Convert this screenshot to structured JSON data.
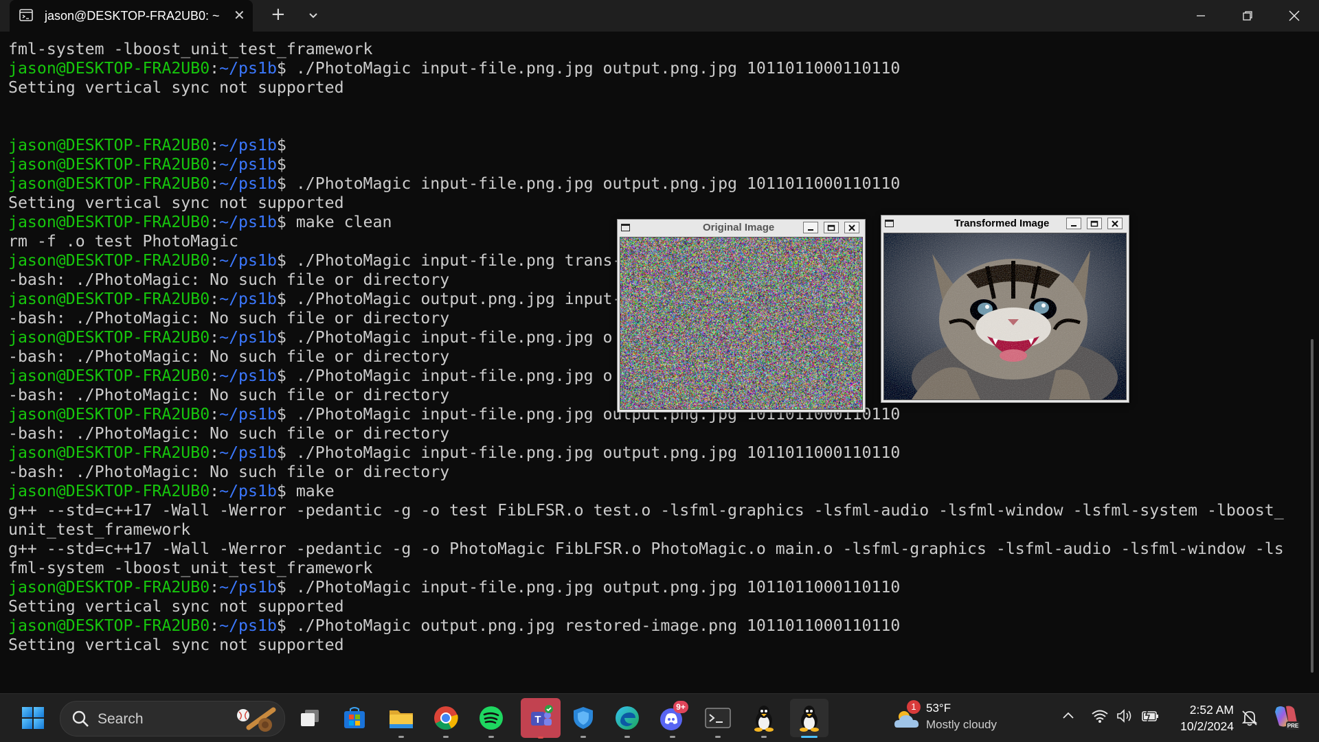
{
  "titlebar": {
    "tab_title": "jason@DESKTOP-FRA2UB0: ~",
    "tab_icon": "terminal-icon",
    "new_tab_icon": "plus-icon",
    "dropdown_icon": "chevron-down-icon"
  },
  "terminal": {
    "colors": {
      "background": "#0c0c0c",
      "text": "#cccccc",
      "user": "#16c60c",
      "path": "#3b78ff"
    },
    "lines": [
      {
        "out": "fml-system -lboost_unit_test_framework"
      },
      {
        "user": "jason@DESKTOP-FRA2UB0",
        "sep": ":",
        "path": "~/ps1b",
        "sign": "$",
        "cmd": " ./PhotoMagic input-file.png.jpg output.png.jpg 1011011000110110"
      },
      {
        "out": "Setting vertical sync not supported"
      },
      {
        "out": ""
      },
      {
        "out": ""
      },
      {
        "user": "jason@DESKTOP-FRA2UB0",
        "sep": ":",
        "path": "~/ps1b",
        "sign": "$",
        "cmd": ""
      },
      {
        "user": "jason@DESKTOP-FRA2UB0",
        "sep": ":",
        "path": "~/ps1b",
        "sign": "$",
        "cmd": ""
      },
      {
        "user": "jason@DESKTOP-FRA2UB0",
        "sep": ":",
        "path": "~/ps1b",
        "sign": "$",
        "cmd": " ./PhotoMagic input-file.png.jpg output.png.jpg 1011011000110110"
      },
      {
        "out": "Setting vertical sync not supported"
      },
      {
        "user": "jason@DESKTOP-FRA2UB0",
        "sep": ":",
        "path": "~/ps1b",
        "sign": "$",
        "cmd": " make clean"
      },
      {
        "out": "rm -f .o test PhotoMagic"
      },
      {
        "user": "jason@DESKTOP-FRA2UB0",
        "sep": ":",
        "path": "~/ps1b",
        "sign": "$",
        "cmd": " ./PhotoMagic input-file.png trans-"
      },
      {
        "out": "-bash: ./PhotoMagic: No such file or directory"
      },
      {
        "user": "jason@DESKTOP-FRA2UB0",
        "sep": ":",
        "path": "~/ps1b",
        "sign": "$",
        "cmd": " ./PhotoMagic output.png.jpg input-"
      },
      {
        "out": "-bash: ./PhotoMagic: No such file or directory"
      },
      {
        "user": "jason@DESKTOP-FRA2UB0",
        "sep": ":",
        "path": "~/ps1b",
        "sign": "$",
        "cmd": " ./PhotoMagic input-file.png.jpg o"
      },
      {
        "out": "-bash: ./PhotoMagic: No such file or directory"
      },
      {
        "user": "jason@DESKTOP-FRA2UB0",
        "sep": ":",
        "path": "~/ps1b",
        "sign": "$",
        "cmd": " ./PhotoMagic input-file.png.jpg o"
      },
      {
        "out": "-bash: ./PhotoMagic: No such file or directory"
      },
      {
        "user": "jason@DESKTOP-FRA2UB0",
        "sep": ":",
        "path": "~/ps1b",
        "sign": "$",
        "cmd": " ./PhotoMagic input-file.png.jpg output.png.jpg 1011011000110110"
      },
      {
        "out": "-bash: ./PhotoMagic: No such file or directory"
      },
      {
        "user": "jason@DESKTOP-FRA2UB0",
        "sep": ":",
        "path": "~/ps1b",
        "sign": "$",
        "cmd": " ./PhotoMagic input-file.png.jpg output.png.jpg 1011011000110110"
      },
      {
        "out": "-bash: ./PhotoMagic: No such file or directory"
      },
      {
        "user": "jason@DESKTOP-FRA2UB0",
        "sep": ":",
        "path": "~/ps1b",
        "sign": "$",
        "cmd": " make"
      },
      {
        "out": "g++ --std=c++17 -Wall -Werror -pedantic -g -o test FibLFSR.o test.o -lsfml-graphics -lsfml-audio -lsfml-window -lsfml-system -lboost_"
      },
      {
        "out": "unit_test_framework"
      },
      {
        "out": "g++ --std=c++17 -Wall -Werror -pedantic -g -o PhotoMagic FibLFSR.o PhotoMagic.o main.o -lsfml-graphics -lsfml-audio -lsfml-window -ls"
      },
      {
        "out": "fml-system -lboost_unit_test_framework"
      },
      {
        "user": "jason@DESKTOP-FRA2UB0",
        "sep": ":",
        "path": "~/ps1b",
        "sign": "$",
        "cmd": " ./PhotoMagic input-file.png.jpg output.png.jpg 1011011000110110"
      },
      {
        "out": "Setting vertical sync not supported"
      },
      {
        "user": "jason@DESKTOP-FRA2UB0",
        "sep": ":",
        "path": "~/ps1b",
        "sign": "$",
        "cmd": " ./PhotoMagic output.png.jpg restored-image.png 1011011000110110"
      },
      {
        "out": "Setting vertical sync not supported"
      }
    ]
  },
  "windows": {
    "original": {
      "title": "Original Image",
      "title_color": "#555555"
    },
    "transformed": {
      "title": "Transformed Image",
      "title_color": "#000000"
    }
  },
  "taskbar": {
    "search_placeholder": "Search",
    "apps": [
      {
        "name": "start-icon"
      },
      {
        "name": "task-view-icon"
      },
      {
        "name": "microsoft-store-icon"
      },
      {
        "name": "file-explorer-icon"
      },
      {
        "name": "chrome-icon"
      },
      {
        "name": "spotify-icon"
      },
      {
        "name": "teams-icon"
      },
      {
        "name": "defender-icon"
      },
      {
        "name": "edge-icon"
      },
      {
        "name": "discord-icon",
        "badge": "9+"
      },
      {
        "name": "terminal-icon"
      },
      {
        "name": "linux-penguin-icon"
      },
      {
        "name": "linux-penguin-icon"
      }
    ],
    "weather": {
      "badge": "1",
      "temp": "53°F",
      "condition": "Mostly cloudy"
    },
    "clock": {
      "time": "2:52 AM",
      "date": "10/2/2024"
    }
  }
}
